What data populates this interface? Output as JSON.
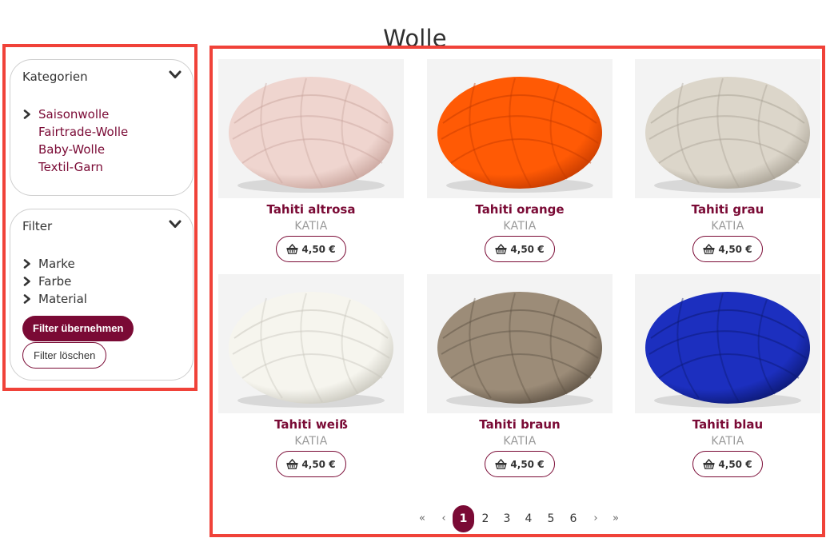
{
  "page": {
    "title": "Wolle"
  },
  "categories": {
    "heading": "Kategorien",
    "items": [
      {
        "label": "Saisonwolle",
        "expandable": true
      },
      {
        "label": "Fairtrade-Wolle",
        "expandable": false
      },
      {
        "label": "Baby-Wolle",
        "expandable": false
      },
      {
        "label": "Textil-Garn",
        "expandable": false
      }
    ]
  },
  "filter": {
    "heading": "Filter",
    "items": [
      {
        "label": "Marke"
      },
      {
        "label": "Farbe"
      },
      {
        "label": "Material"
      }
    ],
    "apply_label": "Filter übernehmen",
    "clear_label": "Filter löschen"
  },
  "products": [
    {
      "name": "Tahiti altrosa",
      "brand": "KATIA",
      "price": "4,50 €",
      "color": "#efd5cf",
      "shade": "#c9a59d"
    },
    {
      "name": "Tahiti orange",
      "brand": "KATIA",
      "price": "4,50 €",
      "color": "#ff5a05",
      "shade": "#c43a00"
    },
    {
      "name": "Tahiti grau",
      "brand": "KATIA",
      "price": "4,50 €",
      "color": "#dcd6ca",
      "shade": "#a8a194"
    },
    {
      "name": "Tahiti weiß",
      "brand": "KATIA",
      "price": "4,50 €",
      "color": "#f6f5ee",
      "shade": "#c8c6bc"
    },
    {
      "name": "Tahiti braun",
      "brand": "KATIA",
      "price": "4,50 €",
      "color": "#9c8c78",
      "shade": "#5e5244"
    },
    {
      "name": "Tahiti blau",
      "brand": "KATIA",
      "price": "4,50 €",
      "color": "#1c2fbf",
      "shade": "#0c1870"
    }
  ],
  "pagination": {
    "first": "«",
    "prev": "‹",
    "pages": [
      "1",
      "2",
      "3",
      "4",
      "5",
      "6"
    ],
    "current": "1",
    "next": "›",
    "last": "»"
  },
  "colors": {
    "accent": "#7a0a35",
    "highlight_frame": "#f04239"
  },
  "icons": {
    "toggle": "chevron-down-icon",
    "expand": "chevron-right-icon",
    "cart": "basket-icon"
  }
}
